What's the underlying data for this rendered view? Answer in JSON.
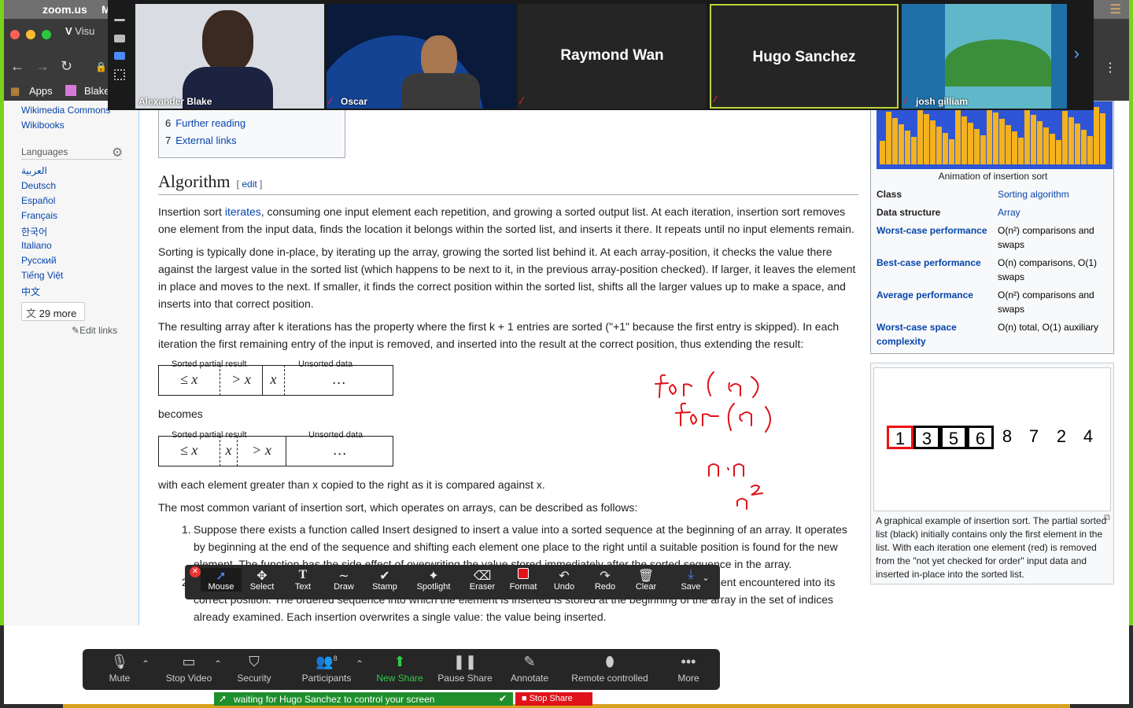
{
  "mac": {
    "app": "zoom.us",
    "extra": "M"
  },
  "chrome": {
    "tab": "Visu",
    "apps": "Apps",
    "blake": "Blake"
  },
  "zoom": {
    "tiles": [
      {
        "name": "Alexander Blake"
      },
      {
        "name": "Oscar"
      },
      {
        "name": "Raymond Wan"
      },
      {
        "name": "Hugo Sanchez"
      },
      {
        "name": "josh gilliam"
      }
    ],
    "toolbar": [
      {
        "icon": "mic-icon",
        "label": "Mute"
      },
      {
        "icon": "video-icon",
        "label": "Stop Video"
      },
      {
        "icon": "shield-icon",
        "label": "Security"
      },
      {
        "icon": "participants-icon",
        "label": "Participants",
        "count": "8"
      },
      {
        "icon": "new-share-icon",
        "label": "New Share"
      },
      {
        "icon": "pause-icon",
        "label": "Pause Share"
      },
      {
        "icon": "annotate-icon",
        "label": "Annotate"
      },
      {
        "icon": "remote-icon",
        "label": "Remote controlled"
      },
      {
        "icon": "more-icon",
        "label": "More"
      }
    ],
    "share_status": "waiting for Hugo Sanchez to control your screen",
    "stop_share": "Stop Share",
    "annotate": [
      {
        "icon": "mouse-icon",
        "label": "Mouse"
      },
      {
        "icon": "select-icon",
        "label": "Select"
      },
      {
        "icon": "text-icon",
        "label": "Text"
      },
      {
        "icon": "draw-icon",
        "label": "Draw"
      },
      {
        "icon": "stamp-icon",
        "label": "Stamp"
      },
      {
        "icon": "spotlight-icon",
        "label": "Spotlight"
      },
      {
        "icon": "eraser-icon",
        "label": "Eraser"
      },
      {
        "icon": "format-icon",
        "label": "Format"
      },
      {
        "icon": "undo-icon",
        "label": "Undo"
      },
      {
        "icon": "redo-icon",
        "label": "Redo"
      },
      {
        "icon": "clear-icon",
        "label": "Clear"
      },
      {
        "icon": "save-icon",
        "label": "Save"
      }
    ]
  },
  "sidebar": {
    "links": [
      "Wikimedia Commons",
      "Wikibooks"
    ],
    "languages_title": "Languages",
    "langs": [
      "العربية",
      "Deutsch",
      "Español",
      "Français",
      "한국어",
      "Italiano",
      "Русский",
      "Tiếng Việt",
      "中文"
    ],
    "more": "29 more",
    "edit_links": "Edit links"
  },
  "toc": [
    {
      "num": "6",
      "text": "Further reading"
    },
    {
      "num": "7",
      "text": "External links"
    }
  ],
  "article": {
    "heading": "Algorithm",
    "edit": "edit",
    "p1a": "Insertion sort ",
    "p1link": "iterates",
    "p1b": ", consuming one input element each repetition, and growing a sorted output list. At each iteration, insertion sort removes one element from the input data, finds the location it belongs within the sorted list, and inserts it there. It repeats until no input elements remain.",
    "p2": "Sorting is typically done in-place, by iterating up the array, growing the sorted list behind it. At each array-position, it checks the value there against the largest value in the sorted list (which happens to be next to it, in the previous array-position checked). If larger, it leaves the element in place and moves to the next. If smaller, it finds the correct position within the sorted list, shifts all the larger values up to make a space, and inserts into that correct position.",
    "p3": "The resulting array after k iterations has the property where the first k + 1 entries are sorted (\"+1\" because the first entry is skipped). In each iteration the first remaining entry of the input is removed, and inserted into the result at the correct position, thus extending the result:",
    "cap_sorted": "Sorted partial result",
    "cap_unsorted": "Unsorted data",
    "a1": [
      "≤ x",
      "> x",
      "x",
      "…"
    ],
    "becomes": "becomes",
    "a2": [
      "≤ x",
      "x",
      "> x",
      "…"
    ],
    "p4": "with each element greater than x copied to the right as it is compared against x.",
    "p5": "The most common variant of insertion sort, which operates on arrays, can be described as follows:",
    "li1": "Suppose there exists a function called Insert designed to insert a value into a sorted sequence at the beginning of an array. It operates by beginning at the end of the sequence and shifting each element one place to the right until a suitable position is found for the new element. The function has the side effect of overwriting the value stored immediately after the sorted sequence in the array.",
    "li2": "To perform an insertion sort, begin at the left-most element of the array and invoke Insert to insert each element encountered into its correct position. The ordered sequence into which the element is inserted is stored at the beginning of the array in the set of indices already examined. Each insertion overwrites a single value: the value being inserted."
  },
  "infobox": {
    "anim_caption": "Animation of insertion sort",
    "rows": [
      {
        "k": "Class",
        "v": "Sorting algorithm",
        "link": true
      },
      {
        "k": "Data structure",
        "v": "Array",
        "link": true
      },
      {
        "k": "Worst-case performance",
        "v": "O(n²) comparisons and swaps"
      },
      {
        "k": "Best-case performance",
        "v": "O(n) comparisons, O(1) swaps"
      },
      {
        "k": "Average performance",
        "v": "O(n²) comparisons and swaps"
      },
      {
        "k": "Worst-case space complexity",
        "v": "O(n) total, O(1) auxiliary"
      }
    ]
  },
  "thumb": {
    "numbers": [
      "1",
      "3",
      "5",
      "6",
      "8",
      "7",
      "2",
      "4"
    ],
    "caption": "A graphical example of insertion sort. The partial sorted list (black) initially contains only the first element in the list. With each iteration one element (red) is removed from the \"not yet checked for order\" input data and inserted in-place into the sorted list."
  },
  "handwriting": [
    "for (n)",
    "for (n)",
    "n·n",
    "n²"
  ],
  "colors": {
    "zoom_green": "#7bd11b",
    "wiki_link": "#0645ad",
    "annotation_red": "#e0121a"
  }
}
